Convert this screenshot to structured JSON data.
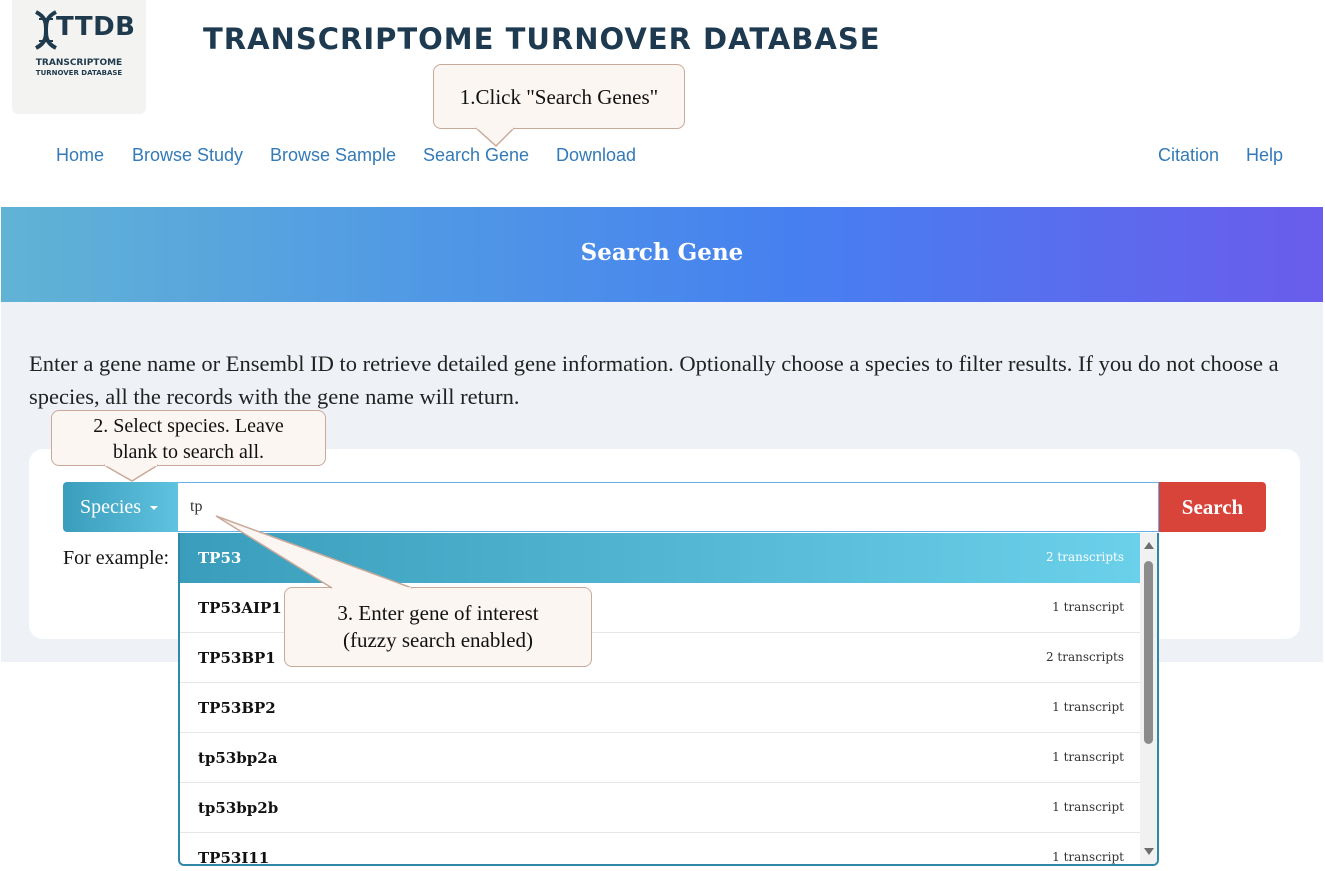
{
  "logo": {
    "title": "TTDB",
    "subtitle_line1": "TRANSCRIPTOME",
    "subtitle_line2": "TURNOVER DATABASE"
  },
  "site_title": "TRANSCRIPTOME TURNOVER DATABASE",
  "nav": {
    "left": [
      {
        "label": "Home"
      },
      {
        "label": "Browse Study"
      },
      {
        "label": "Browse Sample"
      },
      {
        "label": "Search Gene"
      },
      {
        "label": "Download"
      }
    ],
    "right": [
      {
        "label": "Citation"
      },
      {
        "label": "Help"
      }
    ]
  },
  "banner_title": "Search Gene",
  "intro_text": "Enter a gene name or Ensembl ID to retrieve detailed gene information. Optionally choose a species to filter results. If you do not choose a species, all the records with the gene name will return.",
  "search": {
    "species_label": "Species",
    "query": "tp",
    "button_label": "Search",
    "for_example_label": "For example:"
  },
  "suggestions": [
    {
      "name": "TP53",
      "count": "2 transcripts"
    },
    {
      "name": "TP53AIP1",
      "count": "1 transcript"
    },
    {
      "name": "TP53BP1",
      "count": "2 transcripts"
    },
    {
      "name": "TP53BP2",
      "count": "1 transcript"
    },
    {
      "name": "tp53bp2a",
      "count": "1 transcript"
    },
    {
      "name": "tp53bp2b",
      "count": "1 transcript"
    },
    {
      "name": "TP53I11",
      "count": "1 transcript"
    }
  ],
  "callouts": {
    "step1": "1.Click \"Search Genes\"",
    "step2_line1": "2. Select species. Leave",
    "step2_line2": "blank to search all.",
    "step3_line1": "3. Enter gene of interest",
    "step3_line2": "(fuzzy search enabled)"
  },
  "colors": {
    "nav_link": "#337ab7",
    "search_button": "#d9443a",
    "active_suggestion": "#3a9dbb",
    "banner_start": "#61b3d5",
    "banner_end": "#6a5cec"
  }
}
